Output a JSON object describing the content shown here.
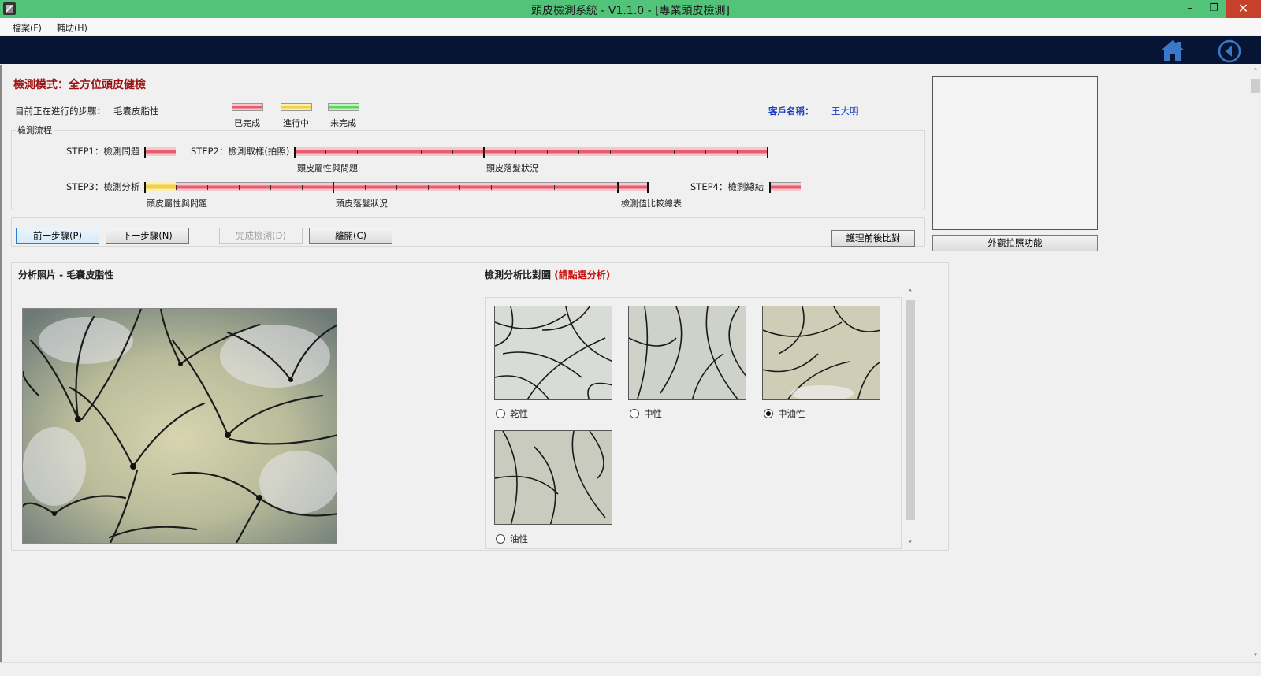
{
  "window": {
    "title": "頭皮檢測系統 - V1.1.0 - [專業頭皮檢測]",
    "minimize_label": "–",
    "restore_label": "❐",
    "close_label": "✕"
  },
  "menu": {
    "items": [
      {
        "label": "檔案(F)"
      },
      {
        "label": "輔助(H)"
      }
    ]
  },
  "toolbar": {
    "home_icon": "home-icon",
    "back_icon": "back-icon",
    "accent": "#3a78c9"
  },
  "header": {
    "mode_title": "檢測模式：全方位頭皮健檢",
    "current_step_label": "目前正在進行的步驟：",
    "current_step_value": "毛囊皮脂性",
    "customer_label": "客戶名稱：",
    "customer_name": "王大明"
  },
  "legend": {
    "done": {
      "label": "已完成",
      "color": "#e85d6e"
    },
    "in_progress": {
      "label": "進行中",
      "color": "#f2d04a"
    },
    "not_done": {
      "label": "未完成",
      "color": "#5fd35f"
    }
  },
  "flow": {
    "group_label": "檢測流程",
    "step1": {
      "label": "STEP1：檢測問題"
    },
    "step2": {
      "label": "STEP2：檢測取樣(拍照)",
      "sub": [
        "頭皮屬性與問題",
        "頭皮落髮狀況"
      ]
    },
    "step3": {
      "label": "STEP3：檢測分析",
      "sub": [
        "頭皮屬性與問題",
        "頭皮落髮狀況",
        "檢測值比較總表"
      ]
    },
    "step4": {
      "label": "STEP4：檢測總結"
    }
  },
  "buttons": {
    "prev": "前一步驟(P)",
    "next": "下一步驟(N)",
    "finish": "完成檢測(D)",
    "leave": "離開(C)",
    "compare": "護理前後比對",
    "appearance_photo": "外觀拍照功能"
  },
  "analysis": {
    "photo_title": "分析照片 - 毛囊皮脂性",
    "compare_title": "檢測分析比對圖",
    "compare_hint": "(請點選分析)",
    "options": [
      {
        "label": "乾性",
        "checked": false
      },
      {
        "label": "中性",
        "checked": false
      },
      {
        "label": "中油性",
        "checked": true
      },
      {
        "label": "油性",
        "checked": false
      }
    ]
  }
}
